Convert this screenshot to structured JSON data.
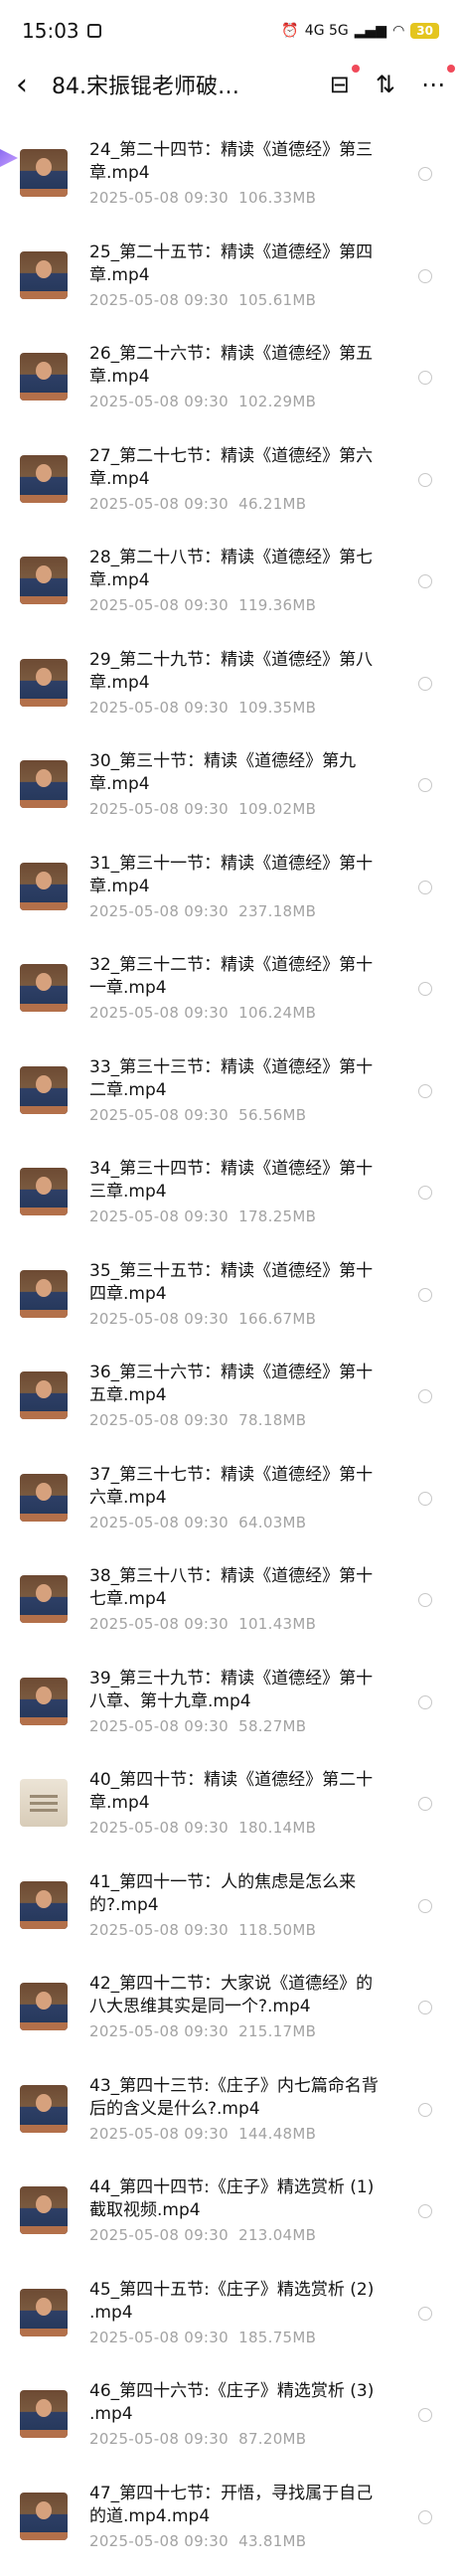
{
  "status": {
    "time": "15:03",
    "battery": "30",
    "network": "4G 5G"
  },
  "header": {
    "title": "84.宋振锟老师破…"
  },
  "files": [
    {
      "name": "24_第二十四节：精读《道德经》第三章.mp4",
      "date": "2025-05-08  09:30",
      "size": "106.33MB"
    },
    {
      "name": "25_第二十五节：精读《道德经》第四章.mp4",
      "date": "2025-05-08  09:30",
      "size": "105.61MB"
    },
    {
      "name": "26_第二十六节：精读《道德经》第五章.mp4",
      "date": "2025-05-08  09:30",
      "size": "102.29MB"
    },
    {
      "name": "27_第二十七节：精读《道德经》第六章.mp4",
      "date": "2025-05-08  09:30",
      "size": "46.21MB"
    },
    {
      "name": "28_第二十八节：精读《道德经》第七章.mp4",
      "date": "2025-05-08  09:30",
      "size": "119.36MB"
    },
    {
      "name": "29_第二十九节：精读《道德经》第八章.mp4",
      "date": "2025-05-08  09:30",
      "size": "109.35MB"
    },
    {
      "name": "30_第三十节：精读《道德经》第九章.mp4",
      "date": "2025-05-08  09:30",
      "size": "109.02MB"
    },
    {
      "name": "31_第三十一节：精读《道德经》第十章.mp4",
      "date": "2025-05-08  09:30",
      "size": "237.18MB"
    },
    {
      "name": "32_第三十二节：精读《道德经》第十一章.mp4",
      "date": "2025-05-08  09:30",
      "size": "106.24MB"
    },
    {
      "name": "33_第三十三节：精读《道德经》第十二章.mp4",
      "date": "2025-05-08  09:30",
      "size": "56.56MB"
    },
    {
      "name": "34_第三十四节：精读《道德经》第十三章.mp4",
      "date": "2025-05-08  09:30",
      "size": "178.25MB"
    },
    {
      "name": "35_第三十五节：精读《道德经》第十四章.mp4",
      "date": "2025-05-08  09:30",
      "size": "166.67MB"
    },
    {
      "name": "36_第三十六节：精读《道德经》第十五章.mp4",
      "date": "2025-05-08  09:30",
      "size": "78.18MB"
    },
    {
      "name": "37_第三十七节：精读《道德经》第十六章.mp4",
      "date": "2025-05-08  09:30",
      "size": "64.03MB"
    },
    {
      "name": "38_第三十八节：精读《道德经》第十七章.mp4",
      "date": "2025-05-08  09:30",
      "size": "101.43MB"
    },
    {
      "name": "39_第三十九节：精读《道德经》第十八章、第十九章.mp4",
      "date": "2025-05-08  09:30",
      "size": "58.27MB"
    },
    {
      "name": "40_第四十节：精读《道德经》第二十章.mp4",
      "date": "2025-05-08  09:30",
      "size": "180.14MB",
      "thumb": "light"
    },
    {
      "name": "41_第四十一节：人的焦虑是怎么来的?.mp4",
      "date": "2025-05-08  09:30",
      "size": "118.50MB"
    },
    {
      "name": "42_第四十二节：大家说《道德经》的八大思维其实是同一个?.mp4",
      "date": "2025-05-08  09:30",
      "size": "215.17MB"
    },
    {
      "name": "43_第四十三节:《庄子》内七篇命名背后的含义是什么?.mp4",
      "date": "2025-05-08  09:30",
      "size": "144.48MB"
    },
    {
      "name": "44_第四十四节:《庄子》精选赏析 (1) 截取视频.mp4",
      "date": "2025-05-08  09:30",
      "size": "213.04MB"
    },
    {
      "name": "45_第四十五节:《庄子》精选赏析 (2) .mp4",
      "date": "2025-05-08  09:30",
      "size": "185.75MB"
    },
    {
      "name": "46_第四十六节:《庄子》精选赏析 (3) .mp4",
      "date": "2025-05-08  09:30",
      "size": "87.20MB"
    },
    {
      "name": "47_第四十七节：开悟，寻找属于自己的道.mp4.mp4",
      "date": "2025-05-08  09:30",
      "size": "43.81MB"
    }
  ]
}
